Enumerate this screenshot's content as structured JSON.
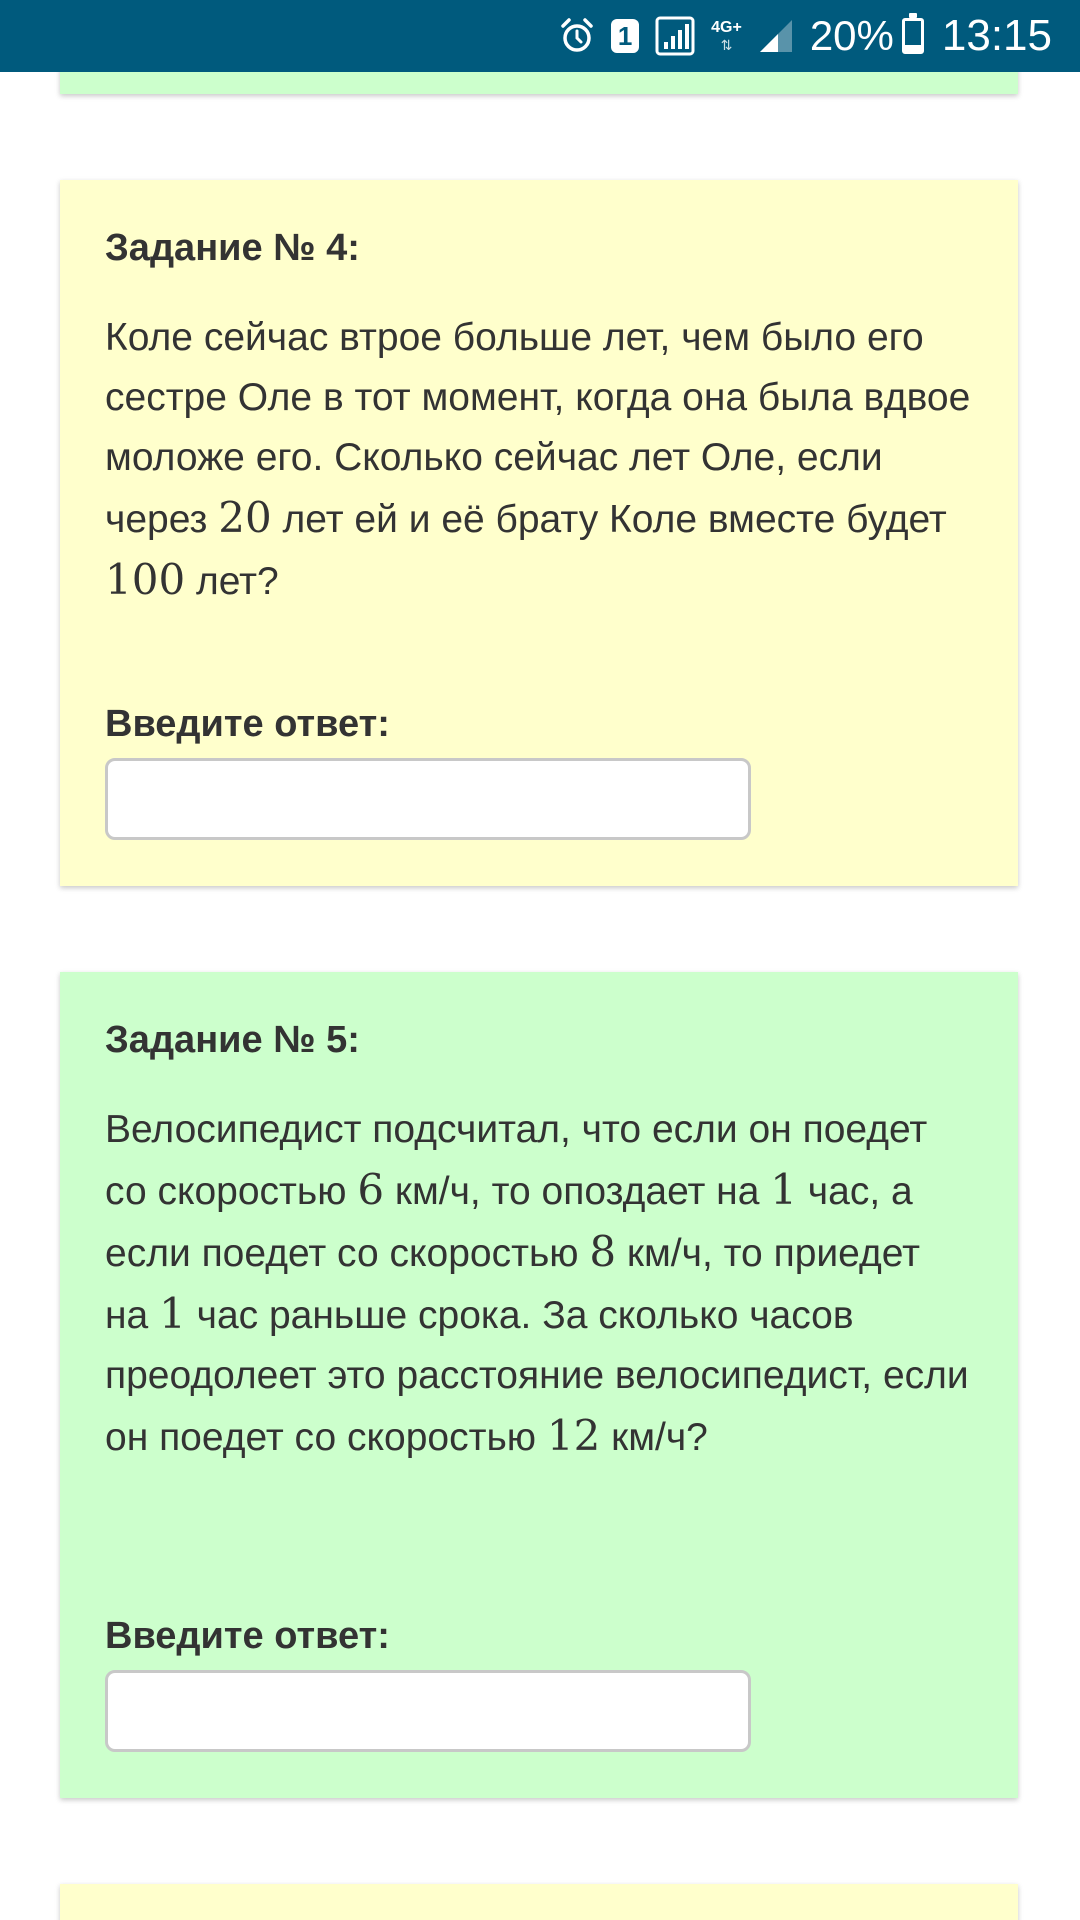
{
  "status_bar": {
    "sim_slot": "1",
    "network_type": "4G+",
    "battery_text": "20%",
    "battery_level": 0.2,
    "time": "13:15"
  },
  "tasks": [
    {
      "title": "Задание № 4:",
      "text_parts": [
        "Коле сейчас втрое больше лет, чем было его сестре Оле в тот момент, когда она была вдвое моложе его. Сколько сейчас лет Оле, если через ",
        "20",
        " лет ей и её брату Коле вместе будет ",
        "100",
        " лет?"
      ],
      "answer_label": "Введите ответ:",
      "answer_value": ""
    },
    {
      "title": "Задание № 5:",
      "text_parts": [
        "Велосипедист подсчитал, что если он поедет со скоростью ",
        "6",
        " км/ч, то опоздает на ",
        "1",
        " час, а если поедет со скоростью ",
        "8",
        " км/ч, то приедет на ",
        "1",
        " час раньше срока. За сколько часов преодолеет это расстояние велосипедист, если он поедет со скоростью ",
        "12",
        " км/ч?"
      ],
      "answer_label": "Введите ответ:",
      "answer_value": ""
    }
  ],
  "colors": {
    "status_bar": "#005a7d",
    "card_green": "#ccffcc",
    "card_yellow": "#ffffcc"
  },
  "icons": {
    "alarm": "alarm-clock-icon",
    "sim": "sim-card-icon",
    "wifi_signal": "signal-bars-icon",
    "mobile_signal": "cell-signal-icon",
    "battery": "battery-icon"
  }
}
